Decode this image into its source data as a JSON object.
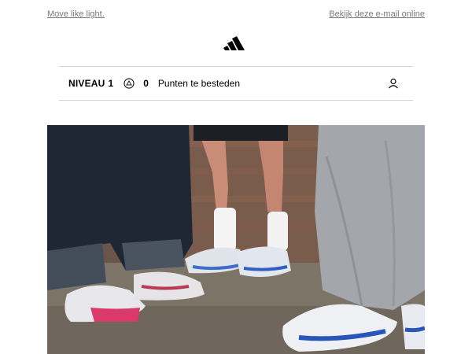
{
  "header": {
    "tagline_link": "Move like light.",
    "view_online_link": "Bekijk deze e-mail online"
  },
  "brand": {
    "logo_icon": "adidas-logo-icon"
  },
  "loyalty": {
    "level_label": "NIVEAU",
    "level_value": "1",
    "coin_icon": "points-coin-icon",
    "points_value": "0",
    "points_label": "Punten te besteden",
    "profile_icon": "user-profile-icon"
  },
  "hero": {
    "image": "photo of sneakers on feet of three people"
  },
  "colors": {
    "link_gray": "#7a7a7a",
    "divider": "#d6d6d6",
    "text": "#000000"
  }
}
